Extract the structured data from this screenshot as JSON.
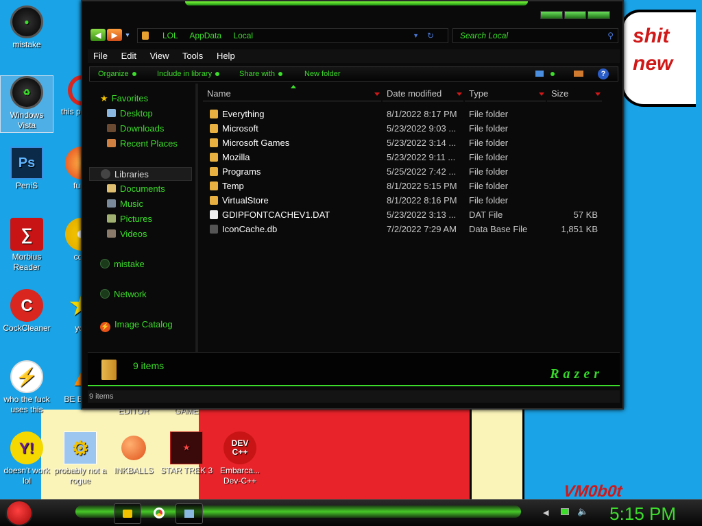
{
  "wallpaper": {
    "bubble_line1": "shit",
    "bubble_line2": "new",
    "corner_text": "VM0b0t"
  },
  "desktop_icons": [
    {
      "label": "mistake"
    },
    {
      "label": "Windows Vista"
    },
    {
      "label": "this p like a"
    },
    {
      "label": "PeniS"
    },
    {
      "label": "furry"
    },
    {
      "label": "Morbius Reader"
    },
    {
      "label": "cd o"
    },
    {
      "label": "CockCleaner"
    },
    {
      "label": "you"
    },
    {
      "label": "who the fuck uses this"
    },
    {
      "label": "BE BEEP"
    },
    {
      "label": "EDITOR"
    },
    {
      "label": "GAME"
    },
    {
      "label": "doesn't work lol"
    },
    {
      "label": "probably not a rogue"
    },
    {
      "label": "INKBALLS"
    },
    {
      "label": "STAR TREK 3"
    },
    {
      "label": "Embarca... Dev-C++"
    }
  ],
  "explorer": {
    "breadcrumb": [
      "LOL",
      "AppData",
      "Local"
    ],
    "search_placeholder": "Search Local",
    "menu": [
      "File",
      "Edit",
      "View",
      "Tools",
      "Help"
    ],
    "toolbar": [
      "Organize",
      "Include in library",
      "Share with",
      "New folder"
    ],
    "nav": {
      "favorites": "Favorites",
      "favorites_items": [
        "Desktop",
        "Downloads",
        "Recent Places"
      ],
      "libraries": "Libraries",
      "libraries_items": [
        "Documents",
        "Music",
        "Pictures",
        "Videos"
      ],
      "user": "mistake",
      "network": "Network",
      "image_catalog": "Image Catalog"
    },
    "columns": [
      "Name",
      "Date modified",
      "Type",
      "Size"
    ],
    "files": [
      {
        "name": "Everything",
        "date": "8/1/2022 8:17 PM",
        "type": "File folder",
        "size": "",
        "kind": "folder"
      },
      {
        "name": "Microsoft",
        "date": "5/23/2022 9:03 ...",
        "type": "File folder",
        "size": "",
        "kind": "folder"
      },
      {
        "name": "Microsoft Games",
        "date": "5/23/2022 3:14 ...",
        "type": "File folder",
        "size": "",
        "kind": "folder"
      },
      {
        "name": "Mozilla",
        "date": "5/23/2022 9:11 ...",
        "type": "File folder",
        "size": "",
        "kind": "folder"
      },
      {
        "name": "Programs",
        "date": "5/25/2022 7:42 ...",
        "type": "File folder",
        "size": "",
        "kind": "folder"
      },
      {
        "name": "Temp",
        "date": "8/1/2022 5:15 PM",
        "type": "File folder",
        "size": "",
        "kind": "folder"
      },
      {
        "name": "VirtualStore",
        "date": "8/1/2022 8:16 PM",
        "type": "File folder",
        "size": "",
        "kind": "folder"
      },
      {
        "name": "GDIPFONTCACHEV1.DAT",
        "date": "5/23/2022 3:13 ...",
        "type": "DAT File",
        "size": "57 KB",
        "kind": "file"
      },
      {
        "name": "IconCache.db",
        "date": "7/2/2022 7:29 AM",
        "type": "Data Base File",
        "size": "1,851 KB",
        "kind": "db"
      }
    ],
    "details_count": "9 items",
    "brand_logo": "Razer",
    "status_text": "9 items"
  },
  "taskbar": {
    "clock": "5:15 PM"
  },
  "colors": {
    "accent": "#3ddd2c",
    "desktop": "#1aa3e6"
  }
}
